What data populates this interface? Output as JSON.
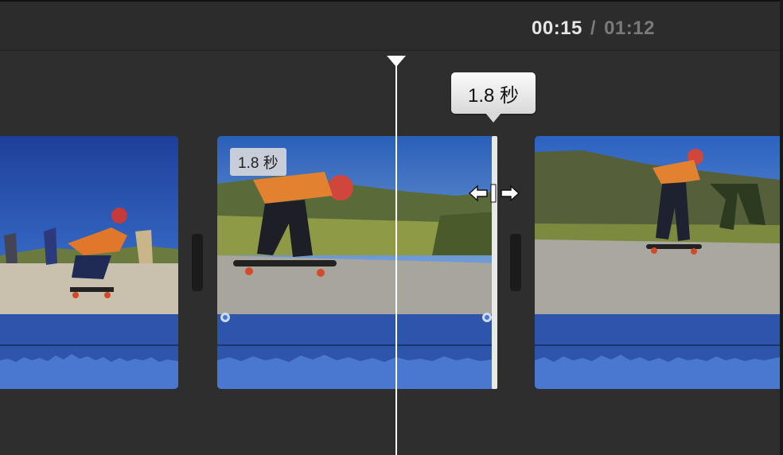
{
  "timecode": {
    "current": "00:15",
    "separator": "/",
    "total": "01:12"
  },
  "trim": {
    "tooltip": "1.8 秒"
  },
  "clips": [
    {
      "name": "clip-1",
      "content": "skateboarder-crouching"
    },
    {
      "name": "clip-2",
      "duration_label": "1.8 秒",
      "content": "skateboarder-riding"
    },
    {
      "name": "clip-3",
      "content": "skateboarder-distance"
    }
  ],
  "colors": {
    "background": "#2e2e2e",
    "audio_waveform": "#2e55a9",
    "playhead": "#ffffff",
    "tooltip": "#f2f2f2"
  }
}
